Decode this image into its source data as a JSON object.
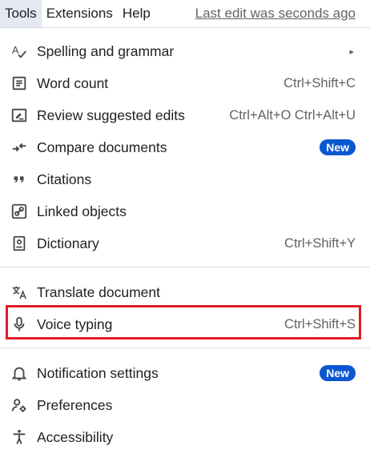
{
  "menubar": {
    "tools_label": "Tools",
    "extensions_label": "Extensions",
    "help_label": "Help",
    "last_edit": "Last edit was seconds ago"
  },
  "menu": {
    "items": [
      {
        "label": "Spelling and grammar",
        "shortcut": "",
        "submenu_arrow": "▸",
        "icon": "spellcheck-icon"
      },
      {
        "label": "Word count",
        "shortcut": "Ctrl+Shift+C",
        "icon": "word-count-icon"
      },
      {
        "label": "Review suggested edits",
        "shortcut": "Ctrl+Alt+O Ctrl+Alt+U",
        "icon": "review-edits-icon"
      },
      {
        "label": "Compare documents",
        "badge": "New",
        "icon": "compare-icon"
      },
      {
        "label": "Citations",
        "shortcut": "",
        "icon": "quote-icon"
      },
      {
        "label": "Linked objects",
        "shortcut": "",
        "icon": "link-icon"
      },
      {
        "label": "Dictionary",
        "shortcut": "Ctrl+Shift+Y",
        "icon": "book-icon"
      },
      {
        "label": "Translate document",
        "shortcut": "",
        "icon": "translate-icon"
      },
      {
        "label": "Voice typing",
        "shortcut": "Ctrl+Shift+S",
        "icon": "microphone-icon"
      },
      {
        "label": "Notification settings",
        "badge": "New",
        "icon": "bell-icon"
      },
      {
        "label": "Preferences",
        "shortcut": "",
        "icon": "preferences-icon"
      },
      {
        "label": "Accessibility",
        "shortcut": "",
        "icon": "accessibility-icon"
      }
    ]
  },
  "colors": {
    "badge_bg": "#0b57d0",
    "highlight": "#e01b24",
    "active_menu_bg": "#e3e8f2"
  }
}
